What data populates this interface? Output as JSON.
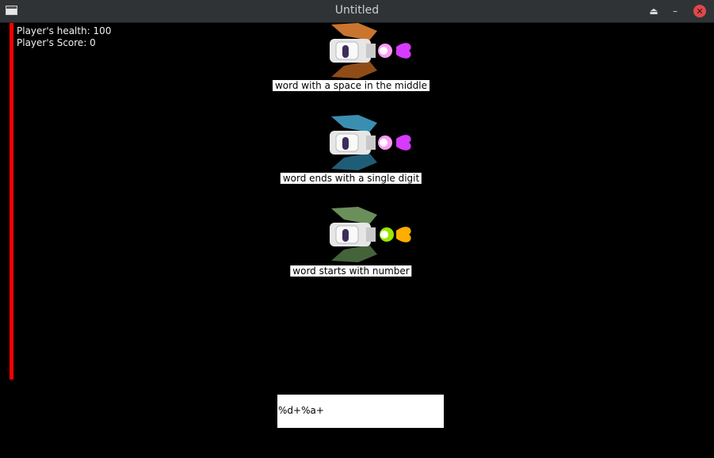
{
  "window": {
    "title": "Untitled",
    "controls": [
      "keep-above-icon",
      "minimize-icon",
      "close-icon"
    ]
  },
  "hud": {
    "health_text": "Player's health: 100",
    "score_text": "Player's Score: 0",
    "health_bar_color": "#ff0000"
  },
  "enemies": [
    {
      "label": "word with a space in the middle",
      "hull_color": "#c9752f",
      "hull_dark": "#8f4c18",
      "flame_color": "#d63bff"
    },
    {
      "label": "word ends with a single digit",
      "hull_color": "#3a8fb0",
      "hull_dark": "#1f5d77",
      "flame_color": "#d63bff"
    },
    {
      "label": "word starts with number",
      "hull_color": "#6b8f5a",
      "hull_dark": "#45633a",
      "flame_color": "#9be600"
    }
  ],
  "input": {
    "value": "%d+%a+"
  }
}
